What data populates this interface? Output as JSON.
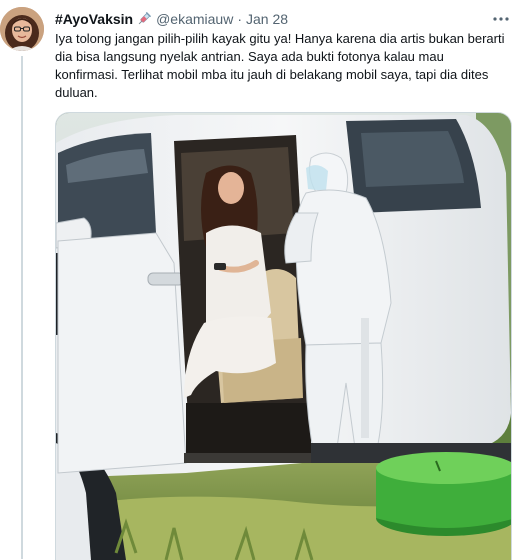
{
  "author": {
    "display_name": "#AyoVaksin",
    "handle": "@ekamiauw",
    "separator": "·",
    "date": "Jan 28",
    "emoji_icon": "syringe-icon"
  },
  "tweet": {
    "text": "Iya tolong jangan pilih-pilih kayak gitu ya! Hanya karena dia artis bukan berarti dia bisa langsung nyelak antrian. Saya ada bukti fotonya kalau mau konfirmasi. Terlihat mobil mba itu jauh di belakang mobil saya, tapi dia dites duluan."
  },
  "media": {
    "alt": "",
    "icon": "photo"
  },
  "icons": {
    "more": "more-horizontal-icon"
  },
  "colors": {
    "text": "#0f1419",
    "secondary": "#536471",
    "thread_line": "#cfd9de"
  }
}
